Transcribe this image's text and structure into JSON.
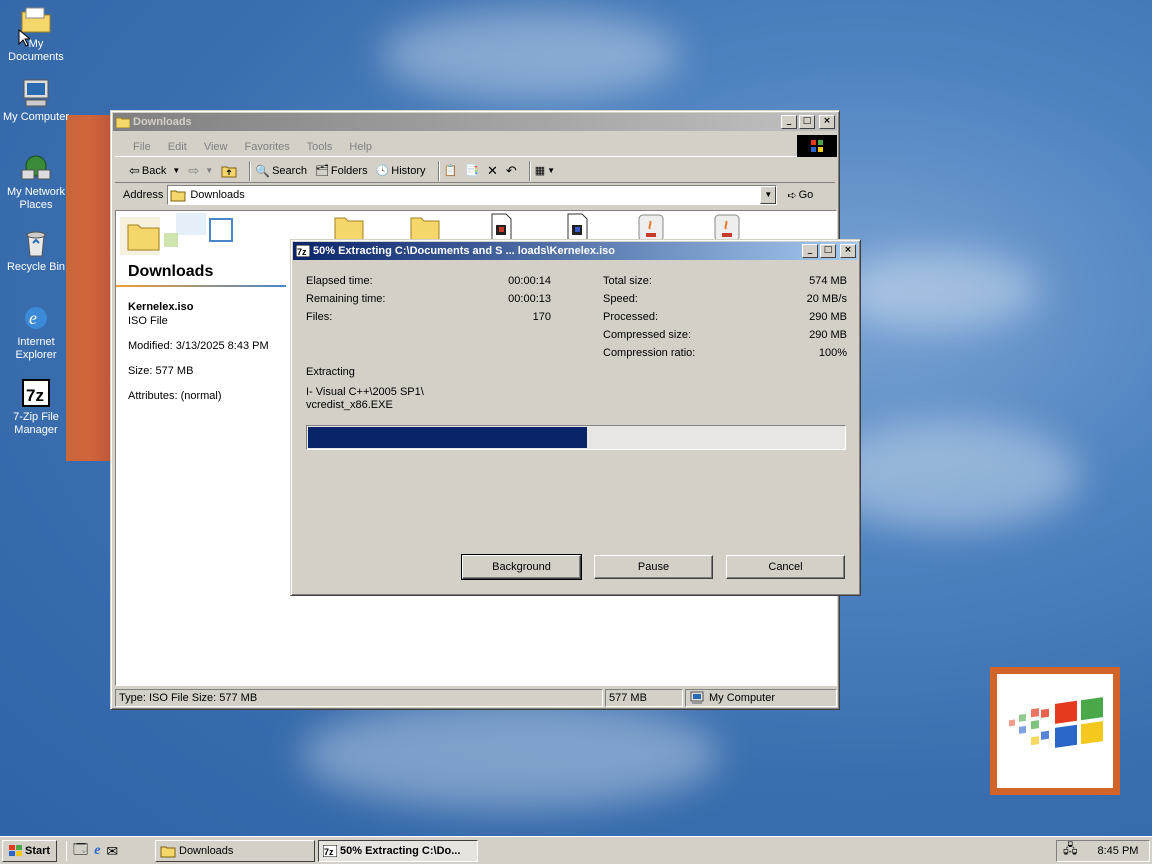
{
  "desktop": {
    "icons": [
      {
        "label": "My Documents",
        "icon": "folder-icon"
      },
      {
        "label": "My Computer",
        "icon": "computer-icon"
      },
      {
        "label": "My Network Places",
        "icon": "network-icon"
      },
      {
        "label": "Recycle Bin",
        "icon": "recycle-bin-icon"
      },
      {
        "label": "Internet Explorer",
        "icon": "internet-explorer-icon"
      },
      {
        "label": "7-Zip File Manager",
        "icon": "7zip-icon"
      }
    ],
    "icon_text_lines": {
      "mydocs": "My Documents",
      "mycomp": "My Computer",
      "net1": "My Network",
      "net2": "Places",
      "recycle": "Recycle Bin",
      "ie1": "Internet",
      "ie2": "Explorer",
      "zip1": "7-Zip File",
      "zip2": "Manager"
    }
  },
  "explorer": {
    "title": "Downloads",
    "menu": [
      "File",
      "Edit",
      "View",
      "Favorites",
      "Tools",
      "Help"
    ],
    "toolbar": {
      "back": "Back",
      "search": "Search",
      "folders": "Folders",
      "history": "History"
    },
    "address_label": "Address",
    "address_value": "Downloads",
    "go_label": "Go",
    "panel": {
      "heading": "Downloads",
      "file_name": "Kernelex.iso",
      "file_type": "ISO File",
      "modified": "Modified: 3/13/2025 8:43 PM",
      "size": "Size: 577 MB",
      "attributes": "Attributes: (normal)"
    },
    "status": {
      "left": "Type: ISO File Size: 577 MB",
      "size": "577 MB",
      "zone": "My Computer"
    }
  },
  "extract_dialog": {
    "title": "50% Extracting C:\\Documents and S ... loads\\Kernelex.iso",
    "left_rows": [
      {
        "label": "Elapsed time:",
        "value": "00:00:14"
      },
      {
        "label": "Remaining time:",
        "value": "00:00:13"
      },
      {
        "label": "Files:",
        "value": "170"
      }
    ],
    "right_rows": [
      {
        "label": "Total size:",
        "value": "574 MB"
      },
      {
        "label": "Speed:",
        "value": "20 MB/s"
      },
      {
        "label": "Processed:",
        "value": "290 MB"
      },
      {
        "label": "Compressed size:",
        "value": "290 MB"
      },
      {
        "label": "Compression ratio:",
        "value": "100%"
      }
    ],
    "operation": "Extracting",
    "current_path_line1": "I- Visual C++\\2005 SP1\\",
    "current_path_line2": "vcredist_x86.EXE",
    "progress_fraction": 0.52,
    "buttons": {
      "background": "Background",
      "pause": "Pause",
      "cancel": "Cancel"
    }
  },
  "taskbar": {
    "start": "Start",
    "tasks": [
      {
        "label": "Downloads"
      },
      {
        "label": "50% Extracting C:\\Do..."
      }
    ],
    "clock": "8:45 PM"
  },
  "colors": {
    "desktop": "#3a6eae",
    "title_active": "#0a246a",
    "progress": "#0a246a",
    "face": "#d4d0c8"
  }
}
